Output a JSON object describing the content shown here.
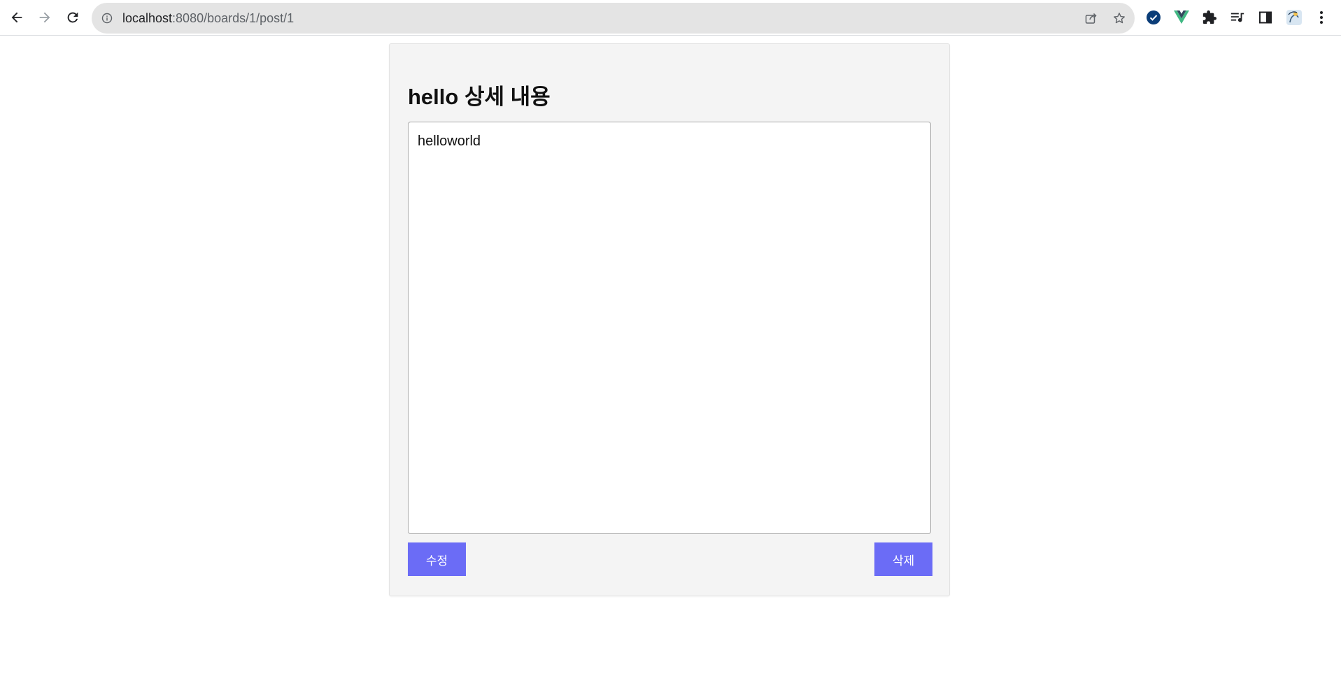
{
  "browser": {
    "url_host": "localhost",
    "url_path": ":8080/boards/1/post/1",
    "icons": [
      "back-icon",
      "forward-icon",
      "reload-icon",
      "site-info-icon",
      "share-icon",
      "bookmark-star-icon",
      "extension-check-icon",
      "vue-devtools-icon",
      "extensions-puzzle-icon",
      "media-control-icon",
      "side-panel-icon",
      "profile-avatar-icon",
      "menu-kebab-icon"
    ],
    "colors": {
      "omnibox_bg": "#e4e4e4",
      "vue_green": "#41b883",
      "check_blue": "#0b3d78"
    }
  },
  "post": {
    "title": "hello 상세 내용",
    "content": "helloworld"
  },
  "actions": {
    "edit_label": "수정",
    "delete_label": "삭제"
  },
  "colors": {
    "button_bg": "#6b6cf6",
    "card_bg": "#f4f4f4"
  }
}
